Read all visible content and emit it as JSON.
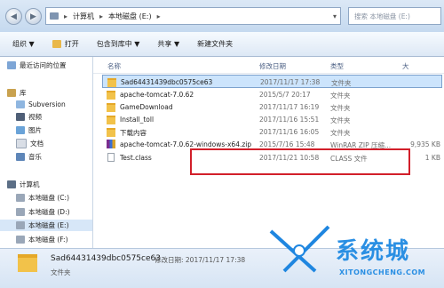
{
  "address": {
    "segments": [
      "计算机",
      "本地磁盘 (E:)"
    ],
    "search_placeholder": "搜索 本地磁盘 (E:)"
  },
  "toolbar": {
    "organize": "组织 ▼",
    "open": "打开",
    "include_in_library": "包含到库中 ▼",
    "share": "共享 ▼",
    "new_folder": "新建文件夹"
  },
  "nav": {
    "recent": "最近访问的位置",
    "library": "库",
    "subversion": "Subversion",
    "video": "视频",
    "pictures": "图片",
    "documents": "文档",
    "music": "音乐",
    "computer": "计算机",
    "drive_c": "本地磁盘 (C:)",
    "drive_d": "本地磁盘 (D:)",
    "drive_e": "本地磁盘 (E:)",
    "drive_f": "本地磁盘 (F:)"
  },
  "columns": {
    "name": "名称",
    "date": "修改日期",
    "type": "类型",
    "size": "大"
  },
  "files": [
    {
      "name": "Sad64431439dbc0575ce63",
      "date": "2017/11/17 17:38",
      "type": "文件夹",
      "size": ""
    },
    {
      "name": "apache-tomcat-7.0.62",
      "date": "2015/5/7 20:17",
      "type": "文件夹",
      "size": ""
    },
    {
      "name": "GameDownload",
      "date": "2017/11/17 16:19",
      "type": "文件夹",
      "size": ""
    },
    {
      "name": "Install_toll",
      "date": "2017/11/16 15:51",
      "type": "文件夹",
      "size": ""
    },
    {
      "name": "下载内容",
      "date": "2017/11/16 16:05",
      "type": "文件夹",
      "size": ""
    },
    {
      "name": "apache-tomcat-7.0.62-windows-x64.zip",
      "date": "2015/7/16 15:48",
      "type": "WinRAR ZIP 压缩...",
      "size": "9,935 KB"
    },
    {
      "name": "Test.class",
      "date": "2017/11/21 10:58",
      "type": "CLASS 文件",
      "size": "1 KB"
    }
  ],
  "status": {
    "name": "Sad64431439dbc0575ce63",
    "modified_label": "修改日期: 2017/11/17 17:38",
    "kind": "文件夹"
  },
  "watermark": {
    "text": "系统城",
    "url": "XITONGCHENG.COM"
  },
  "colors": {
    "highlight_box": "#d21f2a",
    "folder": "#f2c24a",
    "watermark": "#2a8fe3"
  }
}
